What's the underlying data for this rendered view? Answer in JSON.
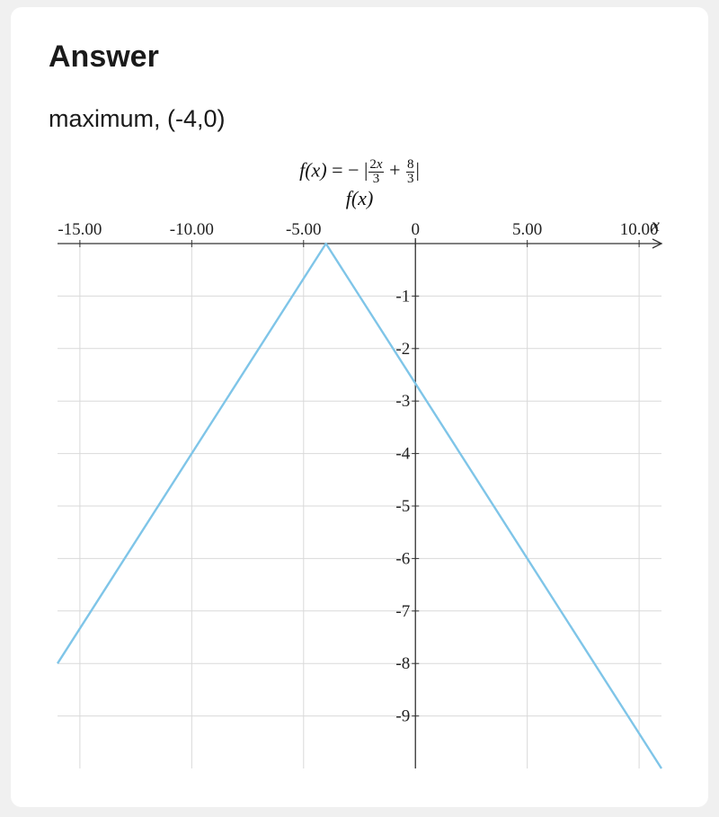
{
  "heading": "Answer",
  "answer_text": "maximum, (-4,0)",
  "equation": {
    "lhs": "f(x)",
    "eq": " = ",
    "neg": "− ",
    "bar_l": "|",
    "f1_num": "2x",
    "f1_den": "3",
    "plus": " + ",
    "f2_num": "8",
    "f2_den": "3",
    "bar_r": "|",
    "sub_label": "f(x)"
  },
  "chart_data": {
    "type": "line",
    "title": "",
    "xlabel": "x",
    "ylabel": "",
    "xlim": [
      -16,
      11
    ],
    "ylim": [
      -10,
      0
    ],
    "x_ticks": [
      -15,
      -10,
      -5,
      0,
      5,
      10
    ],
    "x_tick_labels": [
      "-15.00",
      "-10.00",
      "-5.00",
      "0",
      "5.00",
      "10.00"
    ],
    "y_ticks": [
      -1,
      -2,
      -3,
      -4,
      -5,
      -6,
      -7,
      -8,
      -9
    ],
    "y_tick_labels": [
      "-1",
      "-2",
      "-3",
      "-4",
      "-5",
      "-6",
      "-7",
      "-8",
      "-9"
    ],
    "series": [
      {
        "name": "f(x)",
        "color": "#7fc5e8",
        "x": [
          -16,
          -4,
          11
        ],
        "y": [
          -8,
          0,
          -10
        ]
      }
    ],
    "vertex": {
      "x": -4,
      "y": 0
    }
  }
}
